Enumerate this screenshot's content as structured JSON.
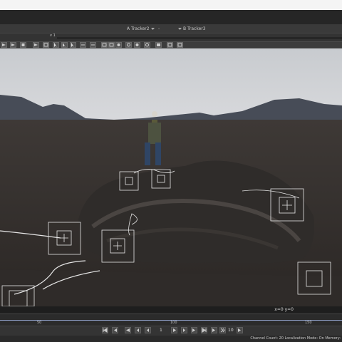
{
  "tracker_bar": {
    "track_a_prefix": "A",
    "track_a": "Tracker2",
    "separator": "-",
    "track_b_prefix": "B",
    "track_b": "Tracker3"
  },
  "view_row": {
    "channel_letter": "v",
    "value": "1"
  },
  "viewer": {
    "coords": "x=0 y=0",
    "icons": [
      "arrow-icon",
      "play-icon",
      "stop-icon",
      "tool-icon"
    ]
  },
  "timeline": {
    "labels": [
      "50",
      "100",
      "150"
    ]
  },
  "transport": {
    "current_frame": "1",
    "step": "10"
  },
  "status": {
    "text": "Channel Count: 20  Localization Mode: On  Memory: "
  }
}
